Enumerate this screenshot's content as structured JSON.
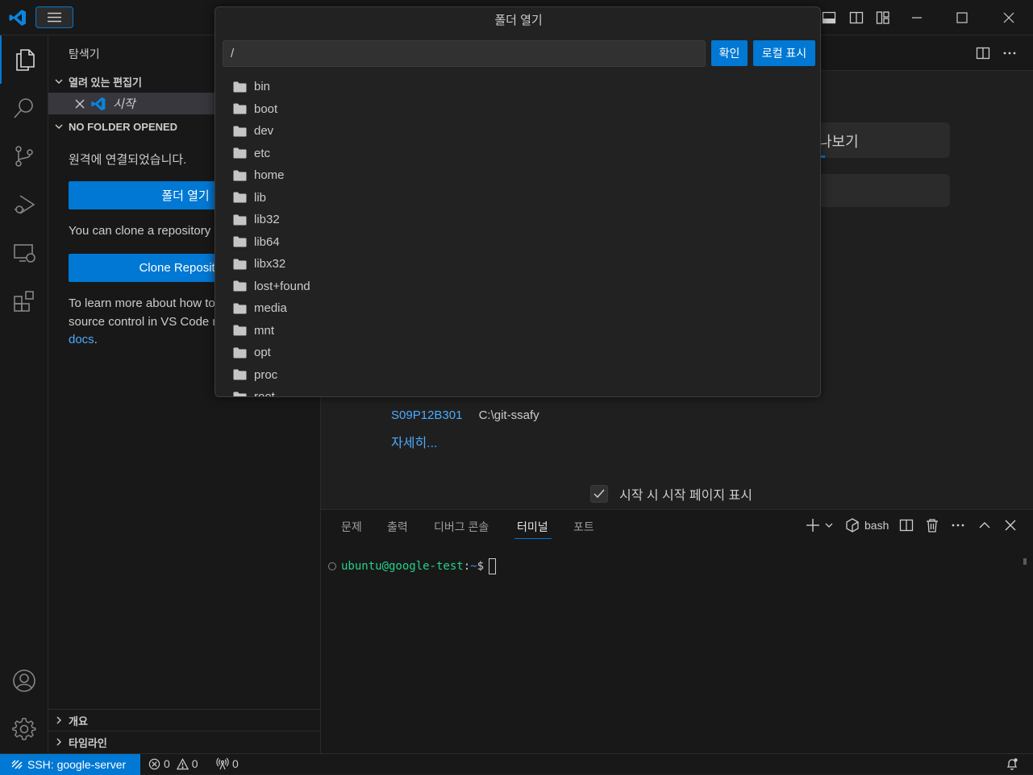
{
  "titlebar": {},
  "dialog": {
    "title": "폴더 열기",
    "path_value": "/",
    "ok_label": "확인",
    "show_local_label": "로컬 표시",
    "folders": [
      "bin",
      "boot",
      "dev",
      "etc",
      "home",
      "lib",
      "lib32",
      "lib64",
      "libx32",
      "lost+found",
      "media",
      "mnt",
      "opt",
      "proc",
      "root"
    ]
  },
  "sidebar": {
    "title": "탐색기",
    "open_editors_label": "열려 있는 편집기",
    "open_editor_item": "시작",
    "no_folder_label": "NO FOLDER OPENED",
    "connected_text": "원격에 연결되었습니다.",
    "open_folder_button": "폴더 열기",
    "clone_text": "You can clone a repository locally.",
    "clone_button": "Clone Repository",
    "learn_line1": "To learn more about how to use Git and",
    "learn_line2": "source control in VS Code read our",
    "docs_link": "docs",
    "docs_period": ".",
    "outline_label": "개요",
    "timeline_label": "타임라인"
  },
  "editor": {
    "walkthrough_partial": "나보기",
    "recent_name": "S09P12B301",
    "recent_path": "C:\\git-ssafy",
    "more_link": "자세히...",
    "show_welcome_label": "시작 시 시작 페이지 표시"
  },
  "panel": {
    "tabs": [
      "문제",
      "출력",
      "디버그 콘솔",
      "터미널",
      "포트"
    ],
    "active_tab": "터미널",
    "shell_label": "bash",
    "prompt_user": "ubuntu@google-test",
    "prompt_sep": ":",
    "prompt_path": "~",
    "prompt_symbol": "$"
  },
  "statusbar": {
    "remote_label": "SSH: google-server",
    "errors": "0",
    "warnings": "0",
    "ports": "0"
  },
  "colors": {
    "accent": "#0078d4",
    "link": "#4daafc",
    "terminal_user": "#23d18b",
    "terminal_path": "#3b8eea"
  }
}
